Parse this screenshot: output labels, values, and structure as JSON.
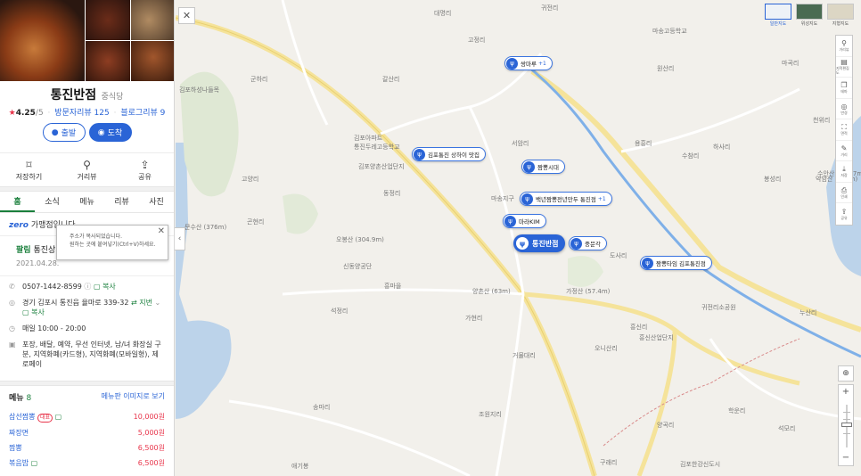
{
  "place": {
    "name": "통진반점",
    "category": "중식당",
    "rating": "4.25",
    "rating_max": "/5",
    "visitor_reviews": "방문자리뷰 125",
    "blog_reviews": "블로그리뷰 9",
    "buttons": {
      "departure": "출발",
      "arrival": "도착"
    },
    "actions": [
      {
        "label": "저장하기",
        "icon": "bookmark-icon"
      },
      {
        "label": "거리뷰",
        "icon": "streetview-icon"
      },
      {
        "label": "공유",
        "icon": "share-icon"
      }
    ]
  },
  "tabs": [
    "홈",
    "소식",
    "메뉴",
    "리뷰",
    "사진"
  ],
  "zero_pay": {
    "logo": "zero",
    "text": "가맹점입니다."
  },
  "notice": {
    "tag": "팔림",
    "title": "통진상기",
    "date": "2021.04.28."
  },
  "tooltip": {
    "line1": "주소가 복사되었습니다.",
    "line2": "원하는 곳에 붙여넣기(Ctrl+V)하세요."
  },
  "info": {
    "phone": "0507-1442-8599",
    "copy": "복사",
    "address": "경기 김포시 통진읍 율마로 339-32",
    "jibun": "지번",
    "hours": "매일 10:00 - 20:00",
    "facilities": "포장, 배달, 예약, 무선 인터넷, 남/녀 화장실 구분, 지역화폐(카드형), 지역화폐(모바일형), 제로페이"
  },
  "menu": {
    "title": "메뉴",
    "count": "8",
    "more_link": "메뉴판 이미지로 보기",
    "items": [
      {
        "name": "삼선짬뽕",
        "badge": "대표",
        "price": "10,000원"
      },
      {
        "name": "짜장면",
        "badge": "",
        "price": "5,000원"
      },
      {
        "name": "짬뽕",
        "badge": "",
        "price": "6,500원"
      },
      {
        "name": "볶음밥",
        "badge": "",
        "price": "6,500원"
      }
    ]
  },
  "map": {
    "types": [
      "일반지도",
      "위성지도",
      "지형지도"
    ],
    "tools": [
      {
        "label": "거리뷰",
        "icon": "streetview-icon"
      },
      {
        "label": "지적편집도",
        "icon": "cadastral-icon"
      },
      {
        "label": "테마",
        "icon": "theme-icon"
      },
      {
        "label": "반경",
        "icon": "radius-icon"
      },
      {
        "label": "면적",
        "icon": "area-icon"
      },
      {
        "label": "거리",
        "icon": "ruler-icon"
      },
      {
        "label": "저장",
        "icon": "save-icon"
      },
      {
        "label": "인쇄",
        "icon": "print-icon"
      },
      {
        "label": "공유",
        "icon": "share-icon"
      }
    ],
    "main_poi": "통진반점",
    "pois": [
      {
        "label": "쌍마루",
        "badge": "+1"
      },
      {
        "label": "김포통진 상하이 맛집",
        "badge": ""
      },
      {
        "label": "짬뽕시대",
        "badge": ""
      },
      {
        "label": "백년짬뽕전년만두 통진점",
        "badge": "+1"
      },
      {
        "label": "마라KIM",
        "badge": ""
      },
      {
        "label": "중문각",
        "badge": ""
      },
      {
        "label": "짬뽕타임 김포통진점",
        "badge": ""
      }
    ],
    "labels": [
      "귀전리",
      "고정리",
      "원산리",
      "마곡리",
      "마송고등학교",
      "갈산리",
      "군하리",
      "김포하성나들목",
      "서암리",
      "용흥리",
      "하사리",
      "천위리",
      "수참리",
      "봉성리",
      "대명리",
      "문수산 (376m)",
      "김포아파트",
      "통진두레고등학교",
      "고양리",
      "동정리",
      "김포양촌산업단지",
      "오봉산 (304.9m)",
      "마송지구",
      "신동양공단",
      "흥마을",
      "곤현리",
      "수안산 (147.7m)",
      "도사리",
      "약암산 (129m)",
      "누산리",
      "석정리",
      "가현리",
      "양촌산 (63m)",
      "가정산 (57.4m)",
      "흥신리",
      "흥신산업단지",
      "귀전리소공원",
      "오니산리",
      "거물대리",
      "송마리",
      "조원지리",
      "양곡리",
      "구래리",
      "학운리",
      "김포한강신도시",
      "애기봉",
      "석모리"
    ]
  }
}
